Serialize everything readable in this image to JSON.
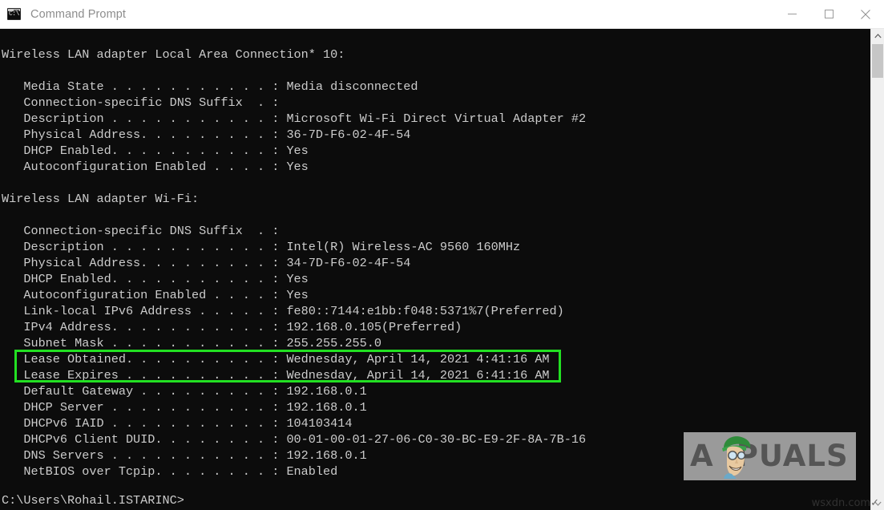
{
  "window": {
    "title": "Command Prompt",
    "icon": "command-prompt-icon",
    "icon_text": "C:\\",
    "controls": {
      "minimize": "Minimize",
      "maximize": "Maximize",
      "close": "Close"
    }
  },
  "console": {
    "background_color": "#0c0c0c",
    "text_color": "#cccccc",
    "output": "Wireless LAN adapter Local Area Connection* 10:\n\n   Media State . . . . . . . . . . . : Media disconnected\n   Connection-specific DNS Suffix  . :\n   Description . . . . . . . . . . . : Microsoft Wi-Fi Direct Virtual Adapter #2\n   Physical Address. . . . . . . . . : 36-7D-F6-02-4F-54\n   DHCP Enabled. . . . . . . . . . . : Yes\n   Autoconfiguration Enabled . . . . : Yes\n\nWireless LAN adapter Wi-Fi:\n\n   Connection-specific DNS Suffix  . :\n   Description . . . . . . . . . . . : Intel(R) Wireless-AC 9560 160MHz\n   Physical Address. . . . . . . . . : 34-7D-F6-02-4F-54\n   DHCP Enabled. . . . . . . . . . . : Yes\n   Autoconfiguration Enabled . . . . : Yes\n   Link-local IPv6 Address . . . . . : fe80::7144:e1bb:f048:5371%7(Preferred)\n   IPv4 Address. . . . . . . . . . . : 192.168.0.105(Preferred)\n   Subnet Mask . . . . . . . . . . . : 255.255.255.0\n   Lease Obtained. . . . . . . . . . : Wednesday, April 14, 2021 4:41:16 AM\n   Lease Expires . . . . . . . . . . : Wednesday, April 14, 2021 6:41:16 AM\n   Default Gateway . . . . . . . . . : 192.168.0.1\n   DHCP Server . . . . . . . . . . . : 192.168.0.1\n   DHCPv6 IAID . . . . . . . . . . . : 104103414\n   DHCPv6 Client DUID. . . . . . . . : 00-01-00-01-27-06-C0-30-BC-E9-2F-8A-7B-16\n   DNS Servers . . . . . . . . . . . : 192.168.0.1\n   NetBIOS over Tcpip. . . . . . . . : Enabled",
    "prompt": "C:\\Users\\Rohail.ISTARINC>"
  },
  "annotation": {
    "color": "#22e022",
    "target_lines": [
      "   Lease Obtained. . . . . . . . . . : Wednesday, April 14, 2021 4:41:16 AM",
      "   Lease Expires . . . . . . . . . . : Wednesday, April 14, 2021 6:41:16 AM"
    ]
  },
  "scrollbar": {
    "up_arrow": "scroll-up-arrow",
    "down_arrow": "scroll-down-arrow",
    "thumb": "scroll-thumb"
  },
  "watermark": {
    "brand": "APPUALS",
    "brand_prefix": "A",
    "brand_suffix": "PUALS",
    "footer": "wsxdn.com",
    "footer_check": "✓"
  }
}
